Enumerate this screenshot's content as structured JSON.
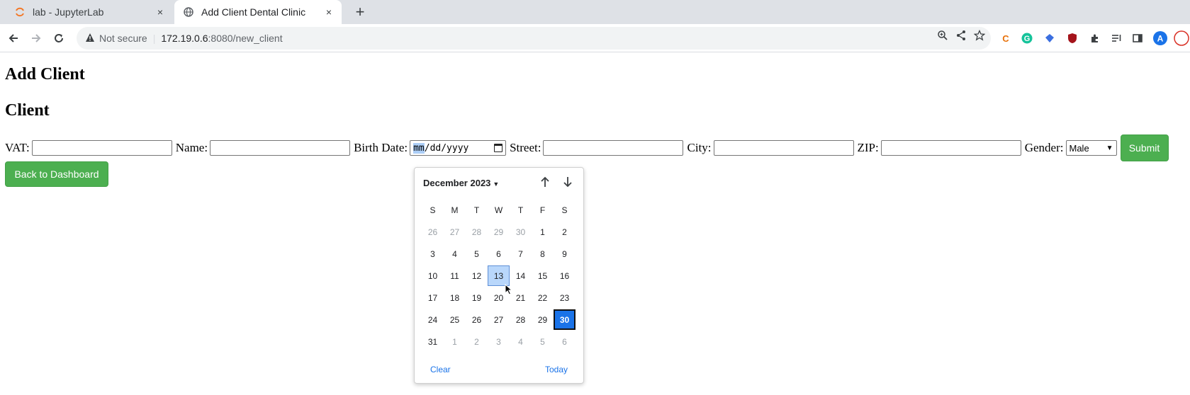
{
  "browser": {
    "tabs": [
      {
        "title": "lab - JupyterLab",
        "close": "×"
      },
      {
        "title": "Add Client Dental Clinic",
        "close": "×"
      }
    ],
    "new_tab": "+",
    "security_label": "Not secure",
    "url_host": "172.19.0.6",
    "url_path": ":8080/new_client"
  },
  "page": {
    "heading": "Add Client",
    "subheading": "Client",
    "form": {
      "vat_label": "VAT:",
      "name_label": "Name:",
      "birth_label": "Birth Date:",
      "birth_mm": "mm",
      "birth_rest": "/dd/yyyy",
      "street_label": "Street:",
      "city_label": "City:",
      "zip_label": "ZIP:",
      "gender_label": "Gender:",
      "gender_value": "Male",
      "submit_label": "Submit"
    },
    "back_label": "Back to Dashboard"
  },
  "calendar": {
    "month_label": "December 2023",
    "weekdays": [
      "S",
      "M",
      "T",
      "W",
      "T",
      "F",
      "S"
    ],
    "weeks": [
      [
        "26",
        "27",
        "28",
        "29",
        "30",
        "1",
        "2"
      ],
      [
        "3",
        "4",
        "5",
        "6",
        "7",
        "8",
        "9"
      ],
      [
        "10",
        "11",
        "12",
        "13",
        "14",
        "15",
        "16"
      ],
      [
        "17",
        "18",
        "19",
        "20",
        "21",
        "22",
        "23"
      ],
      [
        "24",
        "25",
        "26",
        "27",
        "28",
        "29",
        "30"
      ],
      [
        "31",
        "1",
        "2",
        "3",
        "4",
        "5",
        "6"
      ]
    ],
    "other_month": [
      [
        true,
        true,
        true,
        true,
        true,
        false,
        false
      ],
      [
        false,
        false,
        false,
        false,
        false,
        false,
        false
      ],
      [
        false,
        false,
        false,
        false,
        false,
        false,
        false
      ],
      [
        false,
        false,
        false,
        false,
        false,
        false,
        false
      ],
      [
        false,
        false,
        false,
        false,
        false,
        false,
        false
      ],
      [
        false,
        true,
        true,
        true,
        true,
        true,
        true
      ]
    ],
    "hovered_day": "13",
    "selected_day": "30",
    "clear_label": "Clear",
    "today_label": "Today"
  },
  "colors": {
    "accent_green": "#4caf50",
    "selected_blue": "#1a73e8",
    "hover_blue": "#b9d7fb"
  }
}
